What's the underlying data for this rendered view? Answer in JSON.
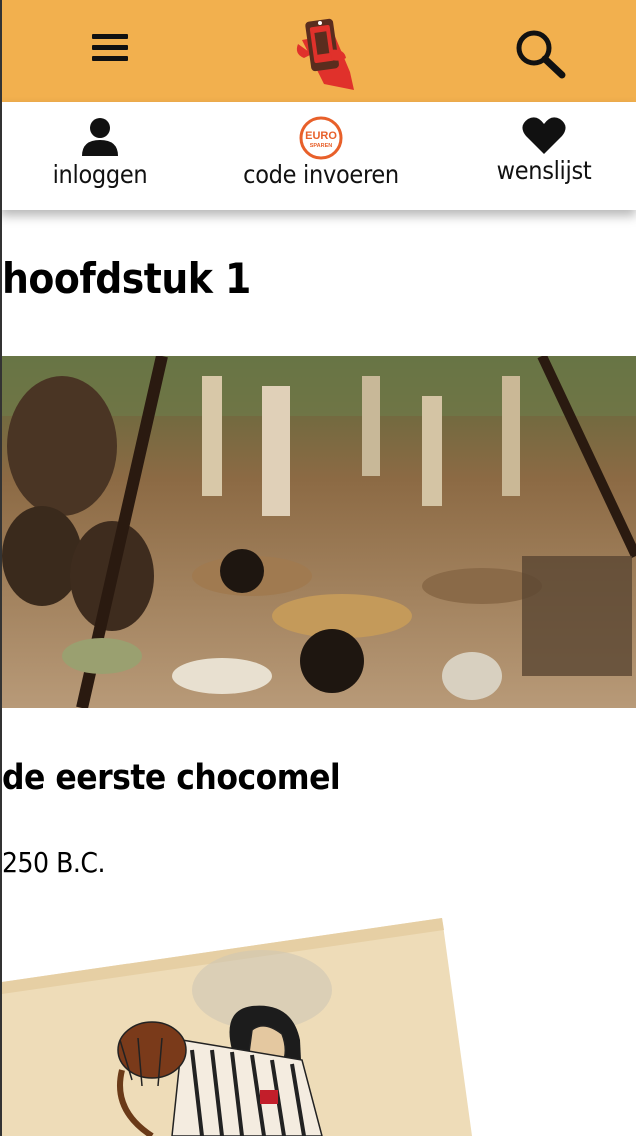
{
  "header": {
    "menu_icon": "hamburger-menu-icon",
    "logo_icon": "hand-holding-phone-logo",
    "search_icon": "magnifier-search-icon",
    "bar_color": "#f2b04e"
  },
  "subnav": {
    "login": {
      "label": "inloggen",
      "icon": "user-icon"
    },
    "code": {
      "label": "code invoeren",
      "icon": "euro-sparen-badge-icon",
      "badge_line1": "EURO",
      "badge_line2": "SPAREN",
      "badge_color": "#e8602a"
    },
    "wishlist": {
      "label": "wenslijst",
      "icon": "heart-icon"
    }
  },
  "content": {
    "chapter_title": "hoofdstuk 1",
    "section_title": "de eerste chocomel",
    "date": "250 B.C."
  }
}
